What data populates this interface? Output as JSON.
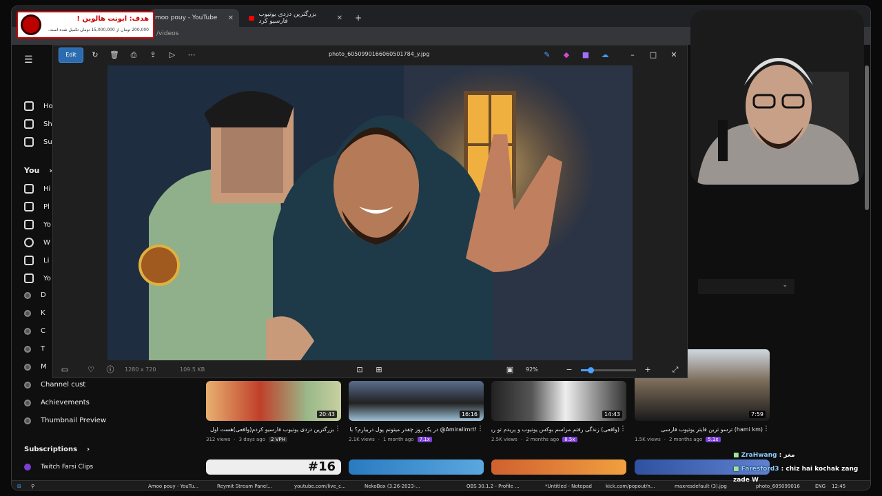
{
  "banner": {
    "title": "هدف: ابونت هالوین !",
    "subtitle": "200,000 تومان از 15,000,000 تومان تکمیل شده است."
  },
  "browser": {
    "tabs": [
      {
        "label": "moo pouy - YouTube"
      },
      {
        "label": "بزرگترین دزدی یوتیوب فارسیو کرد"
      }
    ],
    "url": "/videos"
  },
  "viewer": {
    "edit_label": "Edit",
    "filename": "photo_6050990166060501784_y.jpg",
    "dimensions": "1280 x 720",
    "filesize": "109.5 KB",
    "zoom": "92%"
  },
  "sidebar": {
    "you_label": "You",
    "items": [
      "Ho",
      "Sh",
      "Su",
      "Hi",
      "Pl",
      "Yo",
      "W",
      "Li",
      "Yo",
      "D",
      "K",
      "C",
      "T",
      "M",
      "Channel cust"
    ],
    "achievements": "Achievements",
    "thumbnail_preview": "Thumbnail Preview",
    "subscriptions": "Subscriptions",
    "twitch": "Twitch Farsi Clips"
  },
  "videos": [
    {
      "title": "بزرگترین دزدی یوتیوب فارسیو کردم(واقعی)هست اول",
      "views": "312 views",
      "age": "3 days ago",
      "badge": "2 VPH",
      "duration": "20:43",
      "color": "#e03020"
    },
    {
      "title": "!Amiralimrt@ در یک روز چقدر میتونم پول دربیارم؟ با",
      "views": "2.1K views",
      "age": "1 month ago",
      "badge": "7.1x",
      "duration": "16:16",
      "color": "#556a8a"
    },
    {
      "title": "(واقعی) زندگی رفتم مراسم بوکس یوتیوب و پریدم تو رینگ",
      "views": "2.5K views",
      "age": "2 months ago",
      "badge": "8.5x",
      "duration": "14:43",
      "color": "#445"
    },
    {
      "title": "(hami km) ترسو ترین فایتر یوتیوب فارسی",
      "views": "1.5K views",
      "age": "2 months ago",
      "badge": "5.1x",
      "duration": "7:59",
      "color": "#8a8070"
    }
  ],
  "row2_label": "#16",
  "chat": [
    {
      "user": "ZraHwang",
      "msg": "مغز"
    },
    {
      "user": "Faresford3",
      "msg": "chiz hai kochak zang"
    },
    {
      "user": "zade W",
      "msg": ""
    }
  ],
  "taskbar": {
    "items": [
      "Amoo pouy - YouTu...",
      "Reymit Stream Panel...",
      "youtube.com/live_c...",
      "NekoBox (3.26-2023-...",
      "OBS 30.1.2 - Profile ...",
      "*Untitled - Notepad",
      "kick.com/popout/n...",
      "maxresdefault (3).jpg",
      "photo_605099016606..."
    ],
    "lang": "ENG",
    "time": "12:45"
  }
}
